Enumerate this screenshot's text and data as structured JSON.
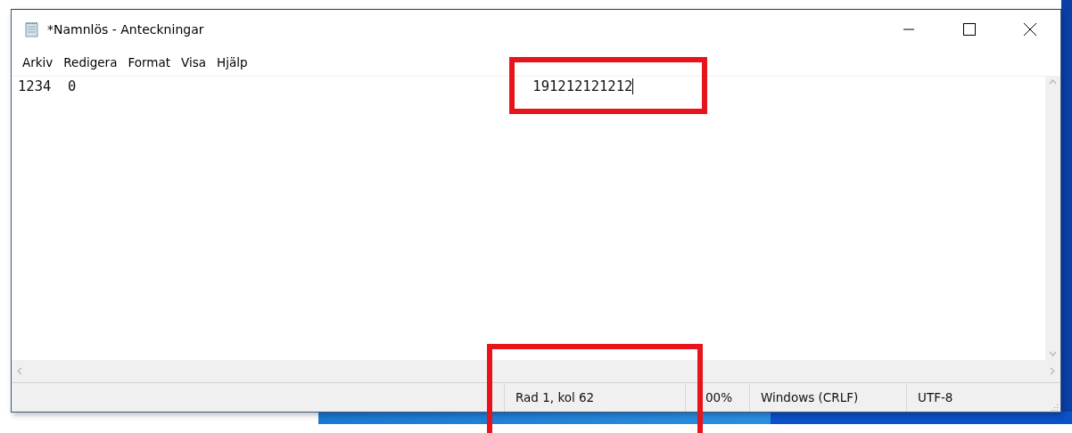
{
  "window": {
    "title": "*Namnlös - Anteckningar"
  },
  "menu": [
    "Arkiv",
    "Redigera",
    "Format",
    "Visa",
    "Hjälp"
  ],
  "editor": {
    "segments": [
      "1234  0",
      "191212121212"
    ]
  },
  "status_bar": [
    "Rad 1, kol 62",
    "00%",
    "Windows (CRLF)",
    "UTF-8"
  ]
}
